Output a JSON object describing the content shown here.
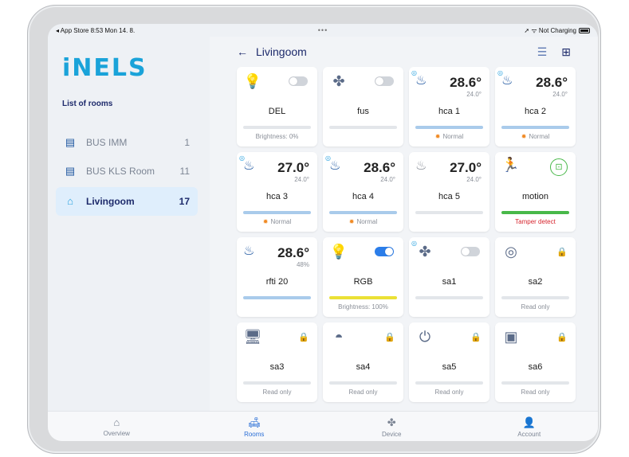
{
  "status": {
    "left": "◂ App Store  8:53  Mon 14. 8.",
    "mid": "•••",
    "right": "➚ ᯤ Not Charging"
  },
  "brand": {
    "logo": "iNELS"
  },
  "sidebar": {
    "title": "List of rooms",
    "rooms": [
      {
        "name": "BUS IMM",
        "count": "1"
      },
      {
        "name": "BUS KLS Room",
        "count": "11"
      },
      {
        "name": "Livingoom",
        "count": "17"
      }
    ]
  },
  "header": {
    "back": "←",
    "title": "Livingoom",
    "list_icon": "☰",
    "grid_icon": "⊞"
  },
  "cards": [
    {
      "name": "DEL",
      "sub": "Brightness: 0%"
    },
    {
      "name": "fus",
      "sub": ""
    },
    {
      "name": "hca 1",
      "temp": "28.6°",
      "set": "24.0°",
      "sub": "Normal"
    },
    {
      "name": "hca 2",
      "temp": "28.6°",
      "set": "24.0°",
      "sub": "Normal"
    },
    {
      "name": "hca 3",
      "temp": "27.0°",
      "set": "24.0°",
      "sub": "Normal"
    },
    {
      "name": "hca 4",
      "temp": "28.6°",
      "set": "24.0°",
      "sub": "Normal"
    },
    {
      "name": "hca 5",
      "temp": "27.0°",
      "set": "24.0°",
      "sub": ""
    },
    {
      "name": "motion",
      "sub": "Tamper detect"
    },
    {
      "name": "rfti 20",
      "temp": "28.6°",
      "set": "48%",
      "sub": ""
    },
    {
      "name": "RGB",
      "sub": "Brightness: 100%"
    },
    {
      "name": "sa1",
      "sub": ""
    },
    {
      "name": "sa2",
      "sub": "Read only"
    },
    {
      "name": "sa3",
      "sub": "Read only"
    },
    {
      "name": "sa4",
      "sub": "Read only"
    },
    {
      "name": "sa5",
      "sub": "Read only"
    },
    {
      "name": "sa6",
      "sub": "Read only"
    }
  ],
  "tabs": [
    {
      "label": "Overview"
    },
    {
      "label": "Rooms"
    },
    {
      "label": "Device"
    },
    {
      "label": "Account"
    }
  ],
  "colors": {
    "accent": "#2b6fd6",
    "brand": "#1aa3d9",
    "normal_icon": "#f08a24",
    "tamper": "#d7262f"
  }
}
